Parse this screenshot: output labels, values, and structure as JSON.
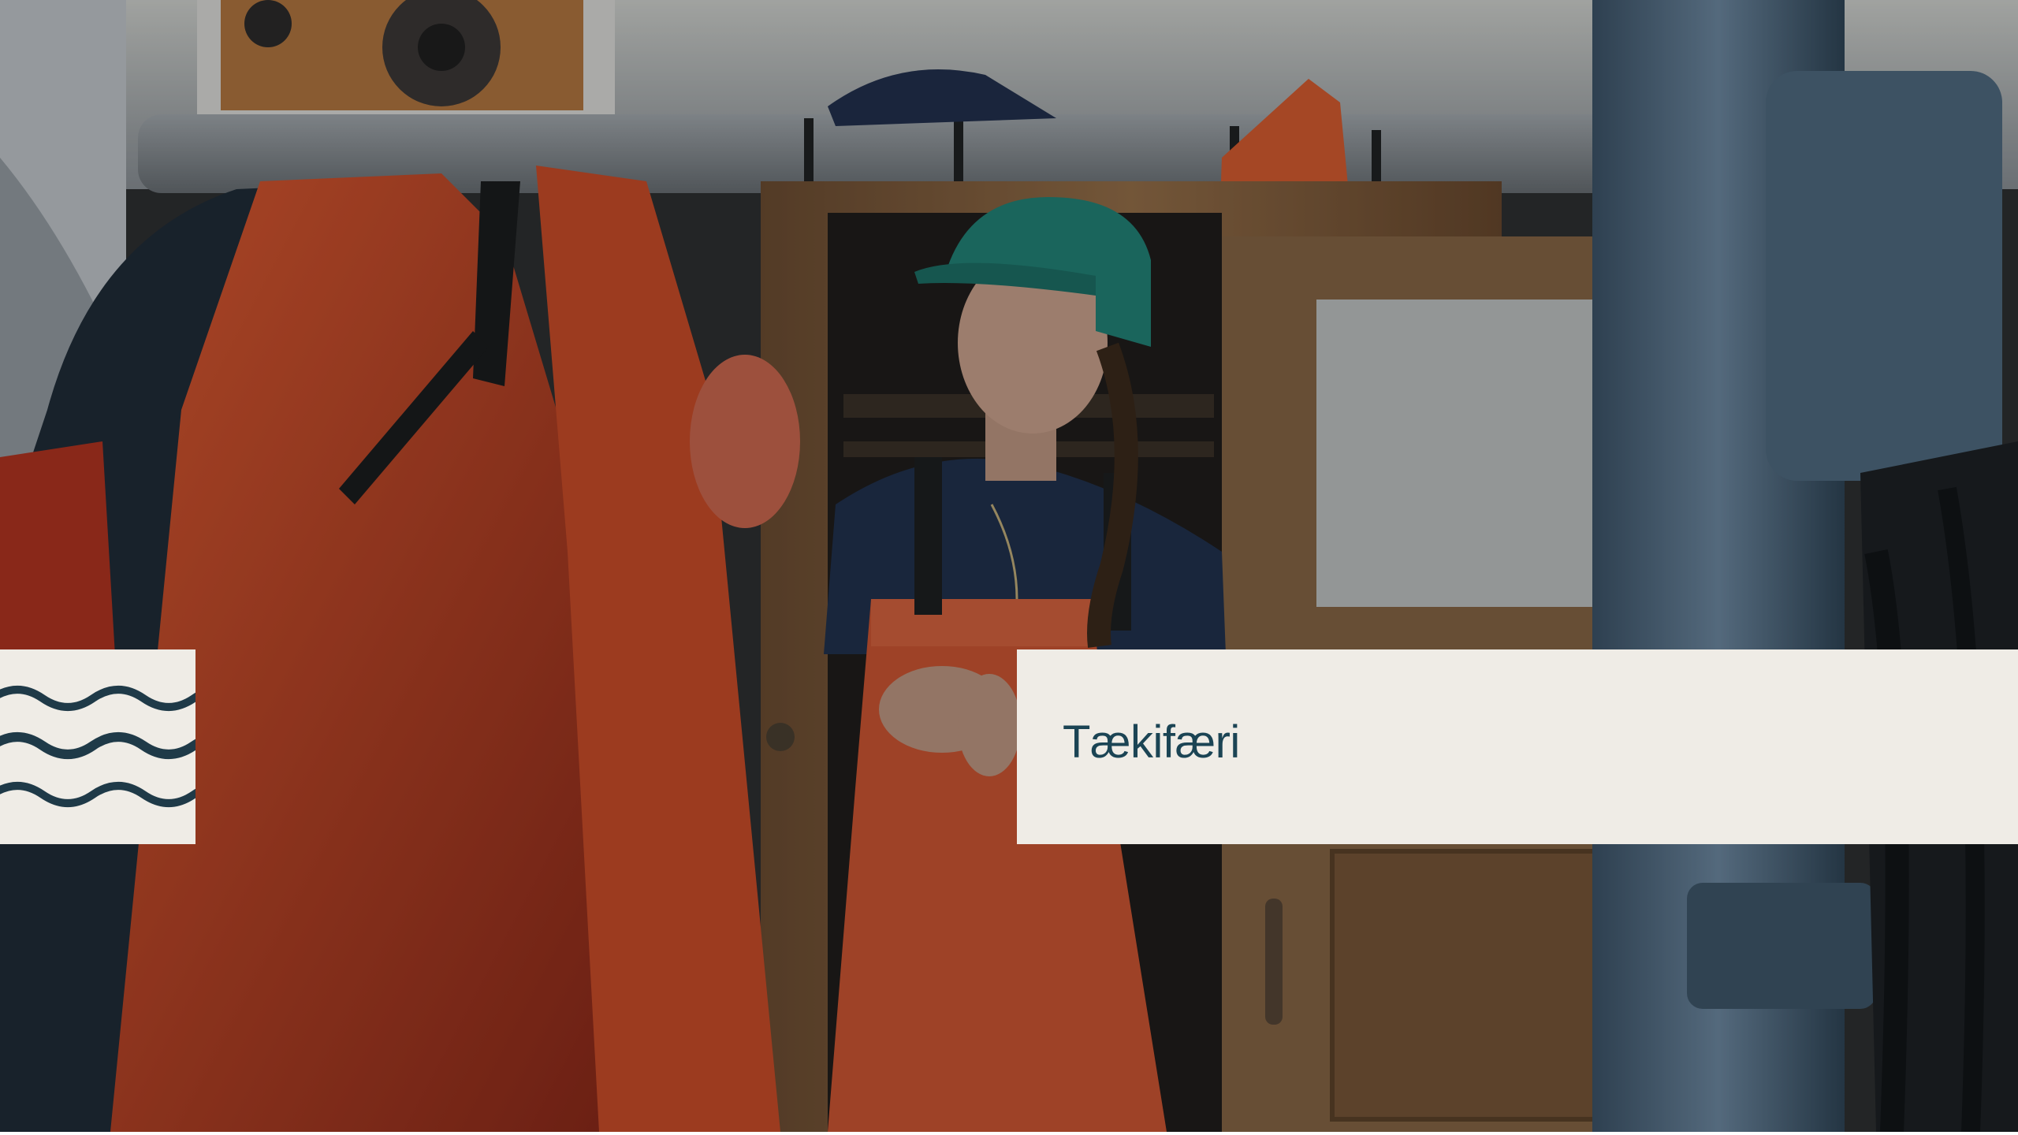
{
  "slide": {
    "title": "Tækifæri",
    "background_image": "photo-fisherwoman-boat-deck",
    "wave_icon": "wave-icon"
  },
  "colors": {
    "banner_bg": "#efece6",
    "title_text": "#1b4454",
    "wave_stroke": "#1f3a48"
  }
}
